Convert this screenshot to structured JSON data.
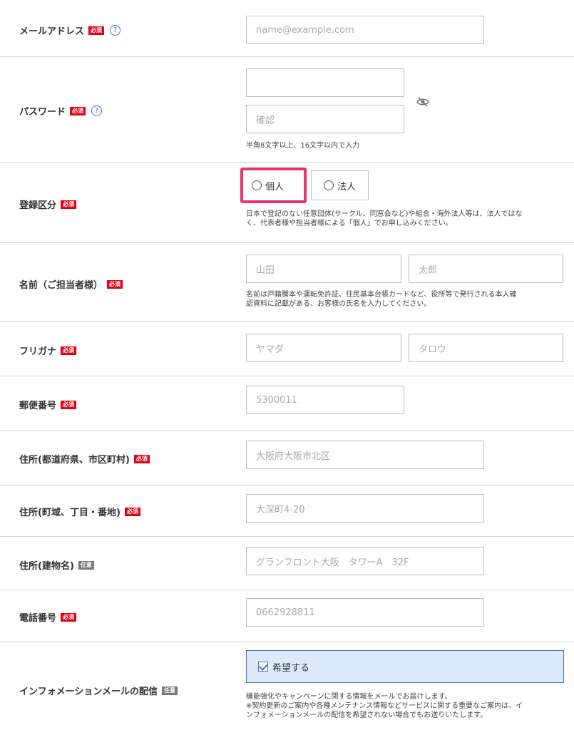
{
  "badges": {
    "required": "必須",
    "optional": "任意"
  },
  "help_glyph": "?",
  "email": {
    "label": "メールアドレス",
    "placeholder": "name@example.com"
  },
  "password": {
    "label": "パスワード",
    "confirm_placeholder": "確認",
    "note": "半角8文字以上、16文字以内で入力"
  },
  "registration": {
    "label": "登録区分",
    "options": [
      {
        "label": "個人"
      },
      {
        "label": "法人"
      }
    ],
    "selected": "個人",
    "note_line1": "日本で登記のない任意団体(サークル、同窓会など)や組合・海外法人等は、法人ではな",
    "note_line2": "く、代表者様や担当者様による「個人」でお申し込みください。"
  },
  "name": {
    "label": "名前（ご担当者様）",
    "last_placeholder": "山田",
    "first_placeholder": "太郎",
    "note_line1": "名前は戸籍謄本や運転免許証、住民基本台帳カードなど、役所等で発行される本人確",
    "note_line2": "認資料に記載がある、お客様の氏名を入力してください。"
  },
  "furigana": {
    "label": "フリガナ",
    "last_placeholder": "ヤマダ",
    "first_placeholder": "タロウ"
  },
  "postal": {
    "label": "郵便番号",
    "placeholder": "5300011"
  },
  "address1": {
    "label": "住所(都道府県、市区町村)",
    "placeholder": "大阪府大阪市北区"
  },
  "address2": {
    "label": "住所(町域、丁目・番地)",
    "placeholder": "大深町4-20"
  },
  "address3": {
    "label": "住所(建物名)",
    "placeholder": "グランフロント大阪　タワーA　32F"
  },
  "phone": {
    "label": "電話番号",
    "placeholder": "0662928811"
  },
  "newsletter": {
    "label": "インフォメーションメールの配信",
    "checkbox_label": "希望する",
    "checked": true,
    "note_line1": "機能強化やキャンペーンに関する情報をメールでお届けします。",
    "note_line2": "※契約更新のご案内や各種メンテナンス情報などサービスに関する重要なご案内は、イ",
    "note_line3": "ンフォメーションメールの配信を希望されない場合でもお送りいたします。"
  },
  "colors": {
    "required_badge": "#e60012",
    "optional_badge": "#777777",
    "selected_highlight": "#e8336d",
    "checkbox_bg": "#dceafb",
    "accent_blue": "#4a6fd6"
  }
}
